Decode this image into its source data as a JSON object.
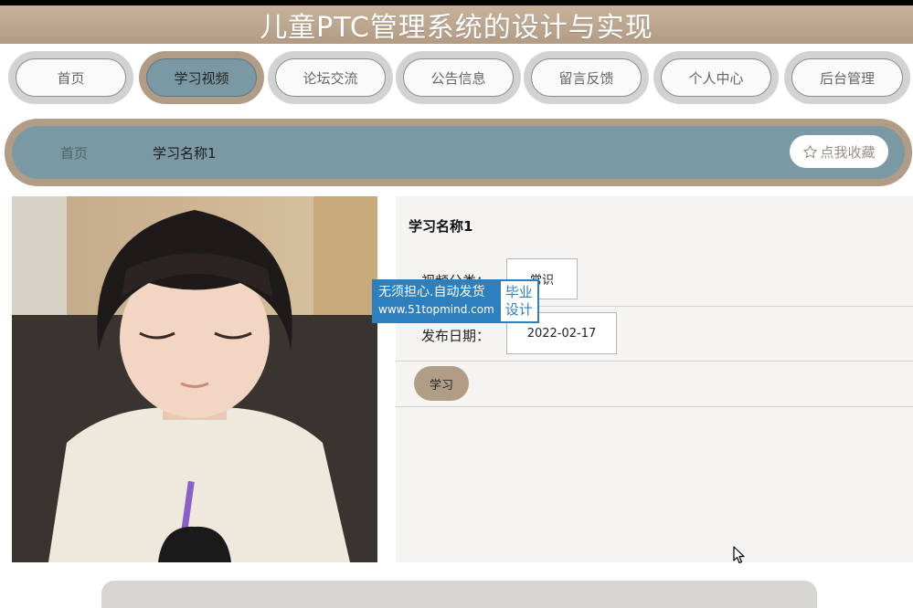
{
  "header": {
    "title": "儿童PTC管理系统的设计与实现"
  },
  "nav": {
    "items": [
      {
        "label": "首页"
      },
      {
        "label": "学习视频"
      },
      {
        "label": "论坛交流"
      },
      {
        "label": "公告信息"
      },
      {
        "label": "留言反馈"
      },
      {
        "label": "个人中心"
      },
      {
        "label": "后台管理"
      }
    ],
    "active_index": 1
  },
  "breadcrumb": {
    "home": "首页",
    "current": "学习名称1"
  },
  "favorite": {
    "icon": "star-outline-icon",
    "label": "点我收藏"
  },
  "detail": {
    "name": "学习名称1",
    "fields": [
      {
        "label": "视频分类：",
        "value": "常识"
      },
      {
        "label": "发布日期：",
        "value": "2022-02-17"
      }
    ],
    "study_button": "学习"
  },
  "watermark": {
    "line1": "无须担心.自动发货",
    "line2": "www.51topmind.com",
    "badge1": "毕业",
    "badge2": "设计"
  },
  "colors": {
    "brand_tan": "#b19d85",
    "brand_teal": "#7a99a5",
    "watermark_blue": "#2e7fc0"
  }
}
